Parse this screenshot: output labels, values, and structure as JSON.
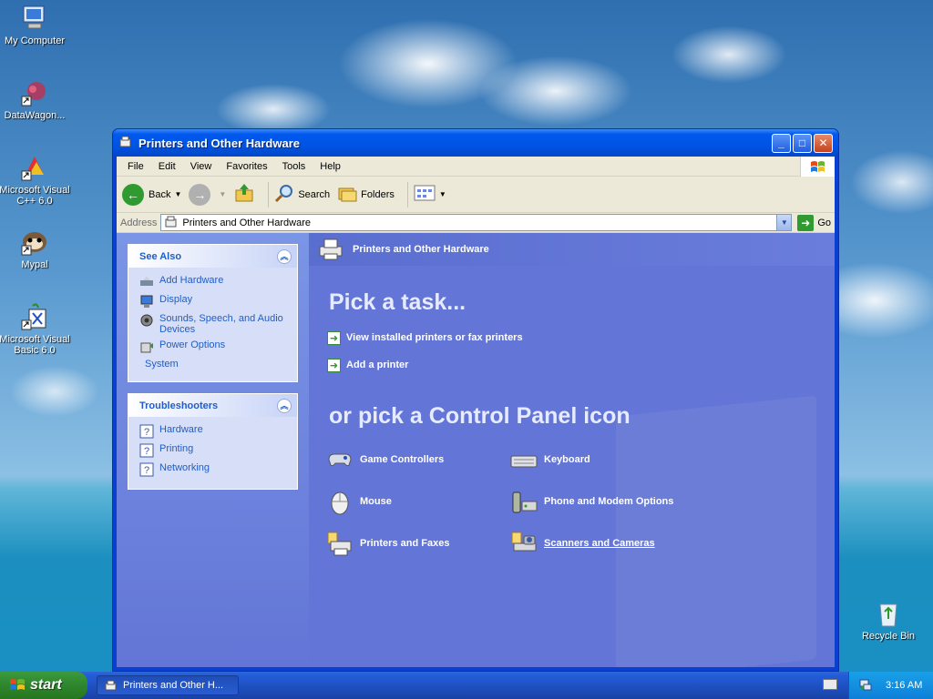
{
  "desktop": {
    "icons": [
      {
        "label": "My Computer"
      },
      {
        "label": "DataWagon..."
      },
      {
        "label": "Microsoft Visual C++ 6.0"
      },
      {
        "label": "Mypal"
      },
      {
        "label": "Microsoft Visual Basic 6.0"
      }
    ],
    "recycle_bin": "Recycle Bin"
  },
  "window": {
    "title": "Printers and Other Hardware",
    "menu": [
      "File",
      "Edit",
      "View",
      "Favorites",
      "Tools",
      "Help"
    ],
    "toolbar": {
      "back": "Back",
      "search": "Search",
      "folders": "Folders"
    },
    "address": {
      "label": "Address",
      "value": "Printers and Other Hardware",
      "go": "Go"
    },
    "see_also": {
      "title": "See Also",
      "items": [
        "Add Hardware",
        "Display",
        "Sounds, Speech, and Audio Devices",
        "Power Options",
        "System"
      ]
    },
    "troubleshooters": {
      "title": "Troubleshooters",
      "items": [
        "Hardware",
        "Printing",
        "Networking"
      ]
    },
    "main": {
      "header": "Printers and Other Hardware",
      "pick_task": "Pick a task...",
      "tasks": [
        "View installed printers or fax printers",
        "Add a printer"
      ],
      "pick_icon": "or pick a Control Panel icon",
      "icons": [
        "Game Controllers",
        "Keyboard",
        "Mouse",
        "Phone and Modem Options",
        "Printers and Faxes",
        "Scanners and Cameras"
      ]
    }
  },
  "taskbar": {
    "start": "start",
    "task_button": "Printers and Other H...",
    "clock": "3:16 AM"
  },
  "colors": {
    "title_blue": "#0054e3",
    "pane_blue": "#6375d6",
    "link_blue": "#215dc6",
    "start_green": "#2e862e"
  }
}
